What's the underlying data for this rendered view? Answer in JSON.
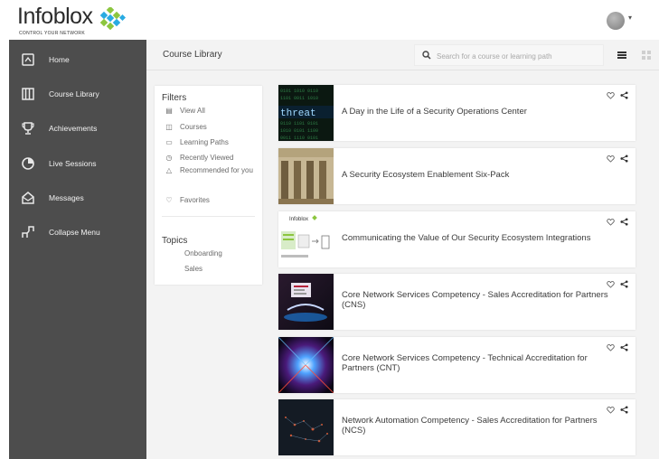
{
  "brand": {
    "name": "Infoblox",
    "tagline": "CONTROL YOUR NETWORK"
  },
  "sidebar": {
    "items": [
      {
        "label": "Home",
        "icon": "home-icon"
      },
      {
        "label": "Course Library",
        "icon": "book-icon"
      },
      {
        "label": "Achievements",
        "icon": "trophy-icon"
      },
      {
        "label": "Live Sessions",
        "icon": "live-sessions-icon"
      },
      {
        "label": "Messages",
        "icon": "messages-icon"
      },
      {
        "label": "Collapse Menu",
        "icon": "collapse-icon"
      }
    ]
  },
  "topbar": {
    "breadcrumb": "Course Library",
    "search_placeholder": "Search for a course or learning path"
  },
  "filters": {
    "title": "Filters",
    "items": [
      {
        "label": "View All",
        "icon": "list-icon"
      },
      {
        "label": "Courses",
        "icon": "book-icon"
      },
      {
        "label": "Learning Paths",
        "icon": "path-icon"
      },
      {
        "label": "Recently Viewed",
        "icon": "clock-icon"
      },
      {
        "label": "Recommended for you",
        "icon": "thumbs-up-icon"
      },
      {
        "label": "Favorites",
        "icon": "heart-icon"
      }
    ]
  },
  "topics": {
    "title": "Topics",
    "items": [
      "Onboarding",
      "Sales"
    ]
  },
  "courses": [
    {
      "title": "A Day in the Life of a Security Operations Center",
      "thumb_word": "threat"
    },
    {
      "title": "A Security Ecosystem Enablement Six-Pack"
    },
    {
      "title": "Communicating the Value of Our Security Ecosystem Integrations",
      "thumb_logo": "Infoblox"
    },
    {
      "title": "Core Network Services Competency - Sales Accreditation for Partners (CNS)"
    },
    {
      "title": "Core Network Services Competency - Technical Accreditation for Partners (CNT)"
    },
    {
      "title": "Network Automation Competency - Sales Accreditation for Partners (NCS)"
    }
  ],
  "colors": {
    "sidebar_bg": "#4d4d4d",
    "content_bg": "#f3f3f3",
    "logo_green": "#8cc63f",
    "logo_blue": "#29abe2"
  }
}
